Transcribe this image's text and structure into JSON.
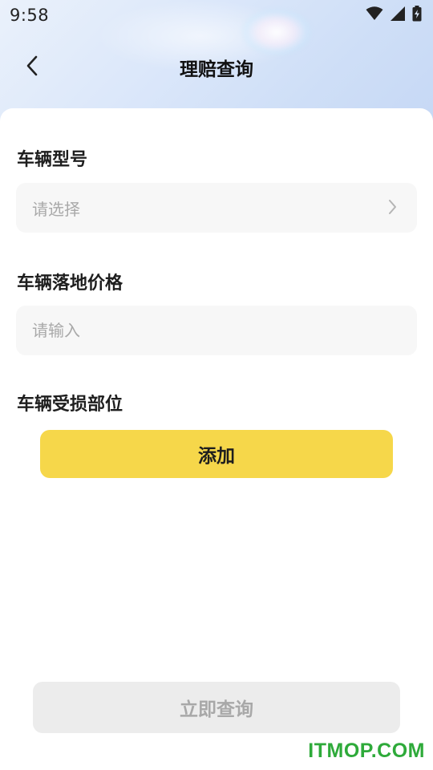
{
  "status_bar": {
    "time": "9:58",
    "icons": [
      "wifi-icon",
      "signal-icon",
      "battery-charging-icon"
    ]
  },
  "nav": {
    "back_icon": "chevron-left-icon",
    "title": "理赔查询"
  },
  "form": {
    "vehicle_model": {
      "label": "车辆型号",
      "placeholder": "请选择",
      "trailing_icon": "chevron-right-icon"
    },
    "vehicle_price": {
      "label": "车辆落地价格",
      "placeholder": "请输入"
    },
    "damaged_parts": {
      "label": "车辆受损部位",
      "add_label": "添加"
    }
  },
  "submit": {
    "label": "立即查询"
  },
  "watermark": "ITMOP.COM",
  "colors": {
    "accent": "#f6d74a",
    "disabled_bg": "#ececec",
    "disabled_text": "#a8a8a8",
    "input_bg": "#f7f7f7",
    "placeholder": "#a9a9a9",
    "watermark": "#2eaa3a"
  }
}
